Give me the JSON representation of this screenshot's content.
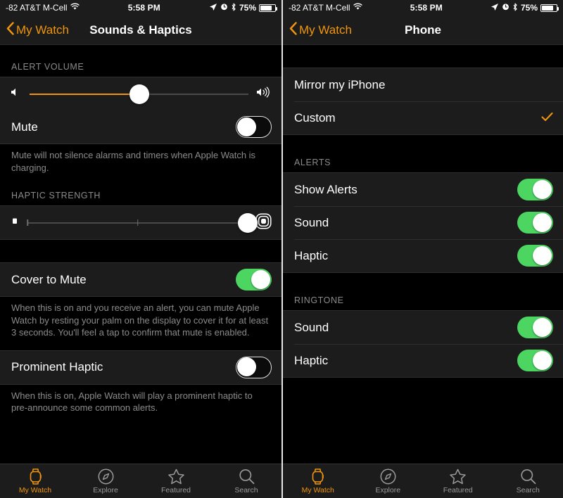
{
  "status_bar": {
    "signal_text": "-82 AT&T M-Cell",
    "wifi_icon": "wifi-icon",
    "time": "5:58 PM",
    "location_icon": "location-arrow-icon",
    "alarm_icon": "alarm-clock-icon",
    "bluetooth_icon": "bluetooth-icon",
    "battery_percent": "75%",
    "battery_icon": "battery-icon"
  },
  "left_panel": {
    "nav": {
      "back_label": "My Watch",
      "back_icon": "chevron-left-icon",
      "title": "Sounds & Haptics"
    },
    "alert_volume": {
      "header": "ALERT VOLUME",
      "min_icon": "speaker-low-icon",
      "max_icon": "speaker-high-icon",
      "value_percent": 50,
      "accent_color": "#f0950d"
    },
    "mute": {
      "label": "Mute",
      "enabled": false,
      "footnote": "Mute will not silence alarms and timers when Apple Watch is charging."
    },
    "haptic_strength": {
      "header": "HAPTIC STRENGTH",
      "min_icon": "haptic-weak-icon",
      "max_icon": "haptic-strong-icon",
      "value_percent": 100,
      "ticks_percent": [
        0,
        50
      ]
    },
    "cover_to_mute": {
      "label": "Cover to Mute",
      "enabled": true,
      "footnote": "When this is on and you receive an alert, you can mute Apple Watch by resting your palm on the display to cover it for at least 3 seconds. You'll feel a tap to confirm that mute is enabled."
    },
    "prominent_haptic": {
      "label": "Prominent Haptic",
      "enabled": false,
      "footnote": "When this is on, Apple Watch will play a prominent haptic to pre-announce some common alerts."
    }
  },
  "right_panel": {
    "nav": {
      "back_label": "My Watch",
      "back_icon": "chevron-left-icon",
      "title": "Phone"
    },
    "mode": {
      "mirror_label": "Mirror my iPhone",
      "mirror_selected": false,
      "custom_label": "Custom",
      "custom_selected": true,
      "check_icon": "checkmark-icon",
      "check_color": "#f0950d"
    },
    "alerts": {
      "header": "ALERTS",
      "rows": [
        {
          "label": "Show Alerts",
          "enabled": true
        },
        {
          "label": "Sound",
          "enabled": true
        },
        {
          "label": "Haptic",
          "enabled": true
        }
      ]
    },
    "ringtone": {
      "header": "RINGTONE",
      "rows": [
        {
          "label": "Sound",
          "enabled": true
        },
        {
          "label": "Haptic",
          "enabled": true
        }
      ]
    }
  },
  "tab_bar": {
    "active_color": "#f0950d",
    "inactive_color": "#9a9a9a",
    "tabs": [
      {
        "label": "My Watch",
        "icon": "apple-watch-icon",
        "active": true
      },
      {
        "label": "Explore",
        "icon": "compass-icon",
        "active": false
      },
      {
        "label": "Featured",
        "icon": "star-icon",
        "active": false
      },
      {
        "label": "Search",
        "icon": "magnifier-icon",
        "active": false
      }
    ]
  }
}
